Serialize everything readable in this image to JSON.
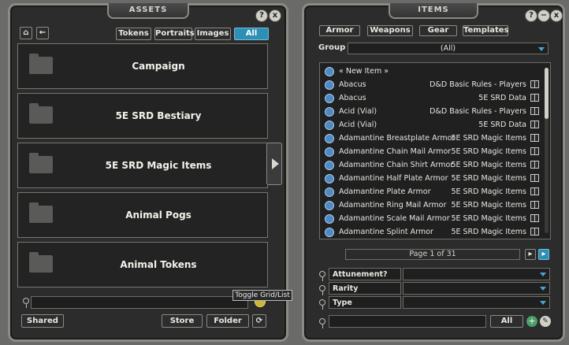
{
  "assets": {
    "title": "ASSETS",
    "help_icon": "?",
    "close_icon": "x",
    "filters": [
      "Tokens",
      "Portraits",
      "Images",
      "All"
    ],
    "active_filter": "All",
    "folders": [
      "Campaign",
      "5E SRD Bestiary",
      "5E SRD Magic Items",
      "Animal Pogs",
      "Animal Tokens"
    ],
    "search_placeholder": "",
    "tooltip": "Toggle Grid/List",
    "bottom": {
      "shared": "Shared",
      "store": "Store",
      "folder": "Folder"
    }
  },
  "items": {
    "title": "ITEMS",
    "tabs": [
      "Armor",
      "Weapons",
      "Gear",
      "Templates"
    ],
    "group_label": "Group",
    "group_value": "(All)",
    "list": [
      {
        "name": "« New Item »",
        "source": ""
      },
      {
        "name": "Abacus",
        "source": "D&D Basic Rules - Players"
      },
      {
        "name": "Abacus",
        "source": "5E SRD Data"
      },
      {
        "name": "Acid (Vial)",
        "source": "D&D Basic Rules - Players"
      },
      {
        "name": "Acid (Vial)",
        "source": "5E SRD Data"
      },
      {
        "name": "Adamantine Breastplate Armor",
        "source": "5E SRD Magic Items"
      },
      {
        "name": "Adamantine Chain Mail Armor",
        "source": "5E SRD Magic Items"
      },
      {
        "name": "Adamantine Chain Shirt Armor",
        "source": "5E SRD Magic Items"
      },
      {
        "name": "Adamantine Half Plate Armor",
        "source": "5E SRD Magic Items"
      },
      {
        "name": "Adamantine Plate Armor",
        "source": "5E SRD Magic Items"
      },
      {
        "name": "Adamantine Ring Mail Armor",
        "source": "5E SRD Magic Items"
      },
      {
        "name": "Adamantine Scale Mail Armor",
        "source": "5E SRD Magic Items"
      },
      {
        "name": "Adamantine Splint Armor",
        "source": "5E SRD Magic Items"
      }
    ],
    "page": "Page 1 of 31",
    "filters": [
      "Attunement?",
      "Rarity",
      "Type"
    ],
    "search_all": "All"
  },
  "colors": {
    "accent": "#2f8eb4",
    "panel": "#2b2c2b",
    "border": "#8b8b85"
  }
}
